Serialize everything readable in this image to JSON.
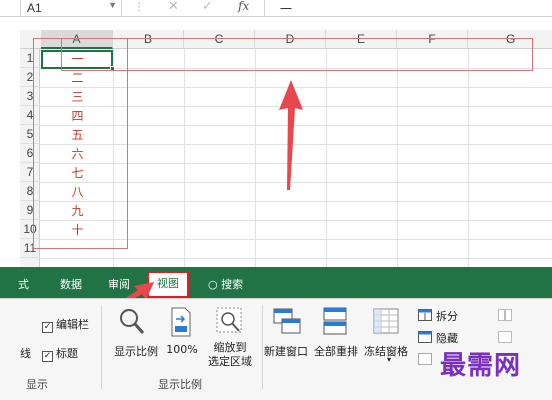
{
  "formula_bar": {
    "name_box": "A1",
    "name_dropdown": "▼",
    "separator": "⋮",
    "cancel": "✕",
    "enter": "✓",
    "fx": "fx",
    "value": "一"
  },
  "columns": [
    "A",
    "B",
    "C",
    "D",
    "E",
    "F",
    "G"
  ],
  "rows": [
    "1",
    "2",
    "3",
    "4",
    "5",
    "6",
    "7",
    "8",
    "9",
    "10",
    "11"
  ],
  "cells_a": [
    "一",
    "二",
    "三",
    "四",
    "五",
    "六",
    "七",
    "八",
    "九",
    "十"
  ],
  "ribbon": {
    "tabs": {
      "formulas_partial": "式",
      "data": "数据",
      "review": "审阅",
      "view": "视图",
      "search": "搜索"
    },
    "show_group": {
      "partial_left": "线",
      "formula_bar": "编辑栏",
      "headings": "标题",
      "label": "显示"
    },
    "zoom_group": {
      "zoom": "显示比例",
      "zoom100": "100%",
      "zoom_selection_1": "缩放到",
      "zoom_selection_2": "选定区域",
      "label": "显示比例"
    },
    "window_group": {
      "new_window": "新建窗口",
      "arrange_all": "全部重排",
      "freeze_panes": "冻结窗格",
      "split": "拆分",
      "hide": "隐藏"
    }
  },
  "watermark": "最需网",
  "colors": {
    "excel_green": "#217346",
    "annotation_red": "#e02020",
    "cell_text_red": "#c0392b"
  }
}
